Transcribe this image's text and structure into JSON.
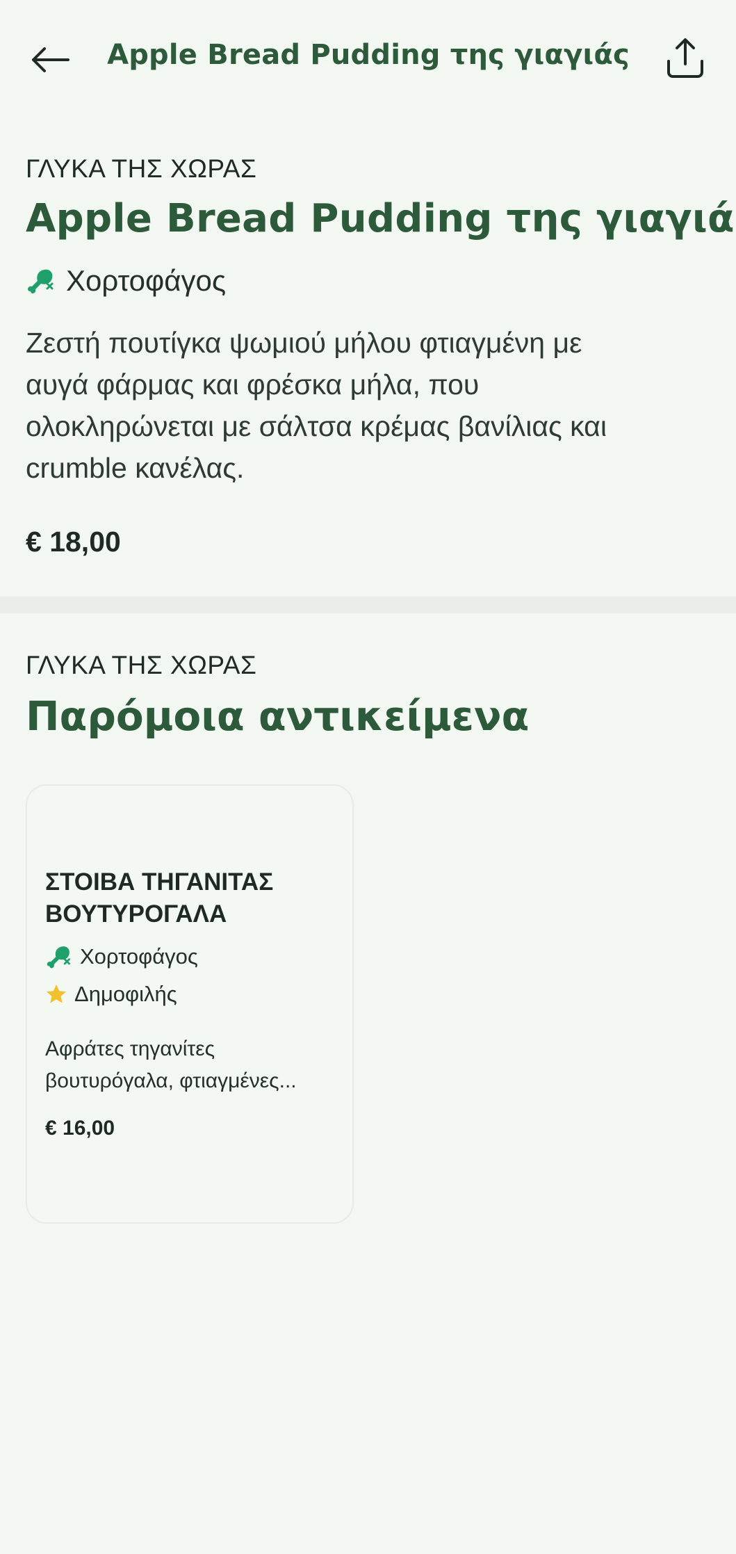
{
  "header": {
    "title": "Apple Bread Pudding της γιαγιάς",
    "back_icon": "arrow-left-icon",
    "share_icon": "share-icon"
  },
  "item": {
    "category": "ΓΛΥΚΑ ΤΗΣ ΧΩΡΑΣ",
    "title": "Apple Bread Pudding της γιαγιάς",
    "tag_label": "Χορτοφάγος",
    "tag_icon": "vegetarian-drumstick-icon",
    "description_lines": [
      "Ζεστή πουτίγκα ψωμιού μήλου φτιαγμένη με",
      "αυγά φάρμας και φρέσκα μήλα, που",
      "ολοκληρώνεται με σάλτσα κρέμας βανίλιας και",
      "crumble κανέλας."
    ],
    "price": "€ 18,00"
  },
  "similar": {
    "category": "ΓΛΥΚΑ ΤΗΣ ΧΩΡΑΣ",
    "title": "Παρόμοια αντικείμενα",
    "cards": [
      {
        "name_lines": [
          "ΣΤΟΙΒΑ ΤΗΓΑΝΙΤΑΣ",
          "ΒΟΥΤΥΡΟΓΑΛΑ"
        ],
        "tags": [
          {
            "label": "Χορτοφάγος",
            "icon": "vegetarian-drumstick-icon"
          },
          {
            "label": "Δημοφιλής",
            "icon": "star-icon"
          }
        ],
        "description_lines": [
          "Αφράτες τηγανίτες",
          "βουτυρόγαλα, φτιαγμένες..."
        ],
        "price": "€ 16,00"
      }
    ]
  },
  "colors": {
    "background": "#f3f7f2",
    "brand_green": "#2d5a3a",
    "veg_green": "#1fa06a",
    "star_yellow": "#f2c12e",
    "divider": "#e8ede7"
  }
}
